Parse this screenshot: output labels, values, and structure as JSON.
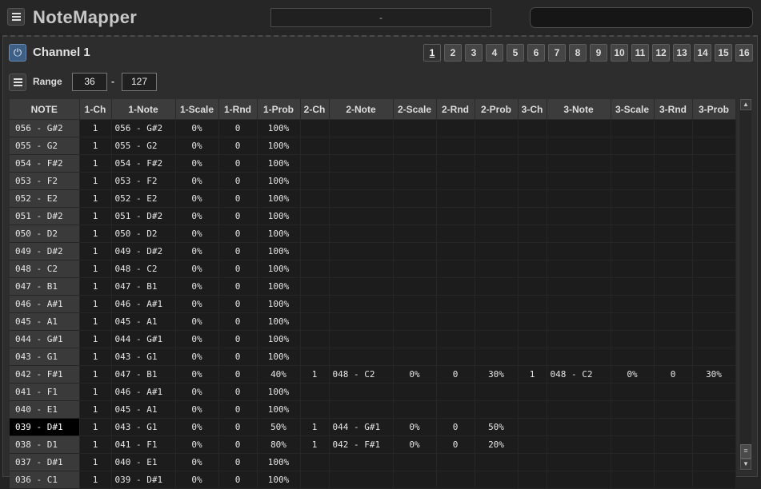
{
  "app": {
    "title": "NoteMapper",
    "preset_value": "-",
    "status_text": ""
  },
  "channel": {
    "title": "Channel 1",
    "power_icon": "power-icon"
  },
  "channel_buttons": [
    "1",
    "2",
    "3",
    "4",
    "5",
    "6",
    "7",
    "8",
    "9",
    "10",
    "11",
    "12",
    "13",
    "14",
    "15",
    "16"
  ],
  "active_channel": "1",
  "range": {
    "label": "Range",
    "from": "36",
    "separator": "-",
    "to": "127"
  },
  "columns": [
    "NOTE",
    "1-Ch",
    "1-Note",
    "1-Scale",
    "1-Rnd",
    "1-Prob",
    "2-Ch",
    "2-Note",
    "2-Scale",
    "2-Rnd",
    "2-Prob",
    "3-Ch",
    "3-Note",
    "3-Scale",
    "3-Rnd",
    "3-Prob"
  ],
  "selected_note": "039 - D#1",
  "rows": [
    [
      "056 - G#2",
      "1",
      "056 - G#2",
      "0%",
      "0",
      "100%",
      "",
      "",
      "",
      "",
      "",
      "",
      "",
      "",
      "",
      ""
    ],
    [
      "055 - G2",
      "1",
      "055 - G2",
      "0%",
      "0",
      "100%",
      "",
      "",
      "",
      "",
      "",
      "",
      "",
      "",
      "",
      ""
    ],
    [
      "054 - F#2",
      "1",
      "054 - F#2",
      "0%",
      "0",
      "100%",
      "",
      "",
      "",
      "",
      "",
      "",
      "",
      "",
      "",
      ""
    ],
    [
      "053 - F2",
      "1",
      "053 - F2",
      "0%",
      "0",
      "100%",
      "",
      "",
      "",
      "",
      "",
      "",
      "",
      "",
      "",
      ""
    ],
    [
      "052 - E2",
      "1",
      "052 - E2",
      "0%",
      "0",
      "100%",
      "",
      "",
      "",
      "",
      "",
      "",
      "",
      "",
      "",
      ""
    ],
    [
      "051 - D#2",
      "1",
      "051 - D#2",
      "0%",
      "0",
      "100%",
      "",
      "",
      "",
      "",
      "",
      "",
      "",
      "",
      "",
      ""
    ],
    [
      "050 - D2",
      "1",
      "050 - D2",
      "0%",
      "0",
      "100%",
      "",
      "",
      "",
      "",
      "",
      "",
      "",
      "",
      "",
      ""
    ],
    [
      "049 - D#2",
      "1",
      "049 - D#2",
      "0%",
      "0",
      "100%",
      "",
      "",
      "",
      "",
      "",
      "",
      "",
      "",
      "",
      ""
    ],
    [
      "048 - C2",
      "1",
      "048 - C2",
      "0%",
      "0",
      "100%",
      "",
      "",
      "",
      "",
      "",
      "",
      "",
      "",
      "",
      ""
    ],
    [
      "047 - B1",
      "1",
      "047 - B1",
      "0%",
      "0",
      "100%",
      "",
      "",
      "",
      "",
      "",
      "",
      "",
      "",
      "",
      ""
    ],
    [
      "046 - A#1",
      "1",
      "046 - A#1",
      "0%",
      "0",
      "100%",
      "",
      "",
      "",
      "",
      "",
      "",
      "",
      "",
      "",
      ""
    ],
    [
      "045 - A1",
      "1",
      "045 - A1",
      "0%",
      "0",
      "100%",
      "",
      "",
      "",
      "",
      "",
      "",
      "",
      "",
      "",
      ""
    ],
    [
      "044 - G#1",
      "1",
      "044 - G#1",
      "0%",
      "0",
      "100%",
      "",
      "",
      "",
      "",
      "",
      "",
      "",
      "",
      "",
      ""
    ],
    [
      "043 - G1",
      "1",
      "043 - G1",
      "0%",
      "0",
      "100%",
      "",
      "",
      "",
      "",
      "",
      "",
      "",
      "",
      "",
      ""
    ],
    [
      "042 - F#1",
      "1",
      "047 - B1",
      "0%",
      "0",
      "40%",
      "1",
      "048 - C2",
      "0%",
      "0",
      "30%",
      "1",
      "048 - C2",
      "0%",
      "0",
      "30%"
    ],
    [
      "041 - F1",
      "1",
      "046 - A#1",
      "0%",
      "0",
      "100%",
      "",
      "",
      "",
      "",
      "",
      "",
      "",
      "",
      "",
      ""
    ],
    [
      "040 - E1",
      "1",
      "045 - A1",
      "0%",
      "0",
      "100%",
      "",
      "",
      "",
      "",
      "",
      "",
      "",
      "",
      "",
      ""
    ],
    [
      "039 - D#1",
      "1",
      "043 - G1",
      "0%",
      "0",
      "50%",
      "1",
      "044 - G#1",
      "0%",
      "0",
      "50%",
      "",
      "",
      "",
      "",
      ""
    ],
    [
      "038 - D1",
      "1",
      "041 - F1",
      "0%",
      "0",
      "80%",
      "1",
      "042 - F#1",
      "0%",
      "0",
      "20%",
      "",
      "",
      "",
      "",
      ""
    ],
    [
      "037 - D#1",
      "1",
      "040 - E1",
      "0%",
      "0",
      "100%",
      "",
      "",
      "",
      "",
      "",
      "",
      "",
      "",
      "",
      ""
    ],
    [
      "036 - C1",
      "1",
      "039 - D#1",
      "0%",
      "0",
      "100%",
      "",
      "",
      "",
      "",
      "",
      "",
      "",
      "",
      "",
      ""
    ]
  ],
  "scrollbar": {
    "up_icon": "▲",
    "down_icon": "▼",
    "thumb_icon": "≡"
  }
}
